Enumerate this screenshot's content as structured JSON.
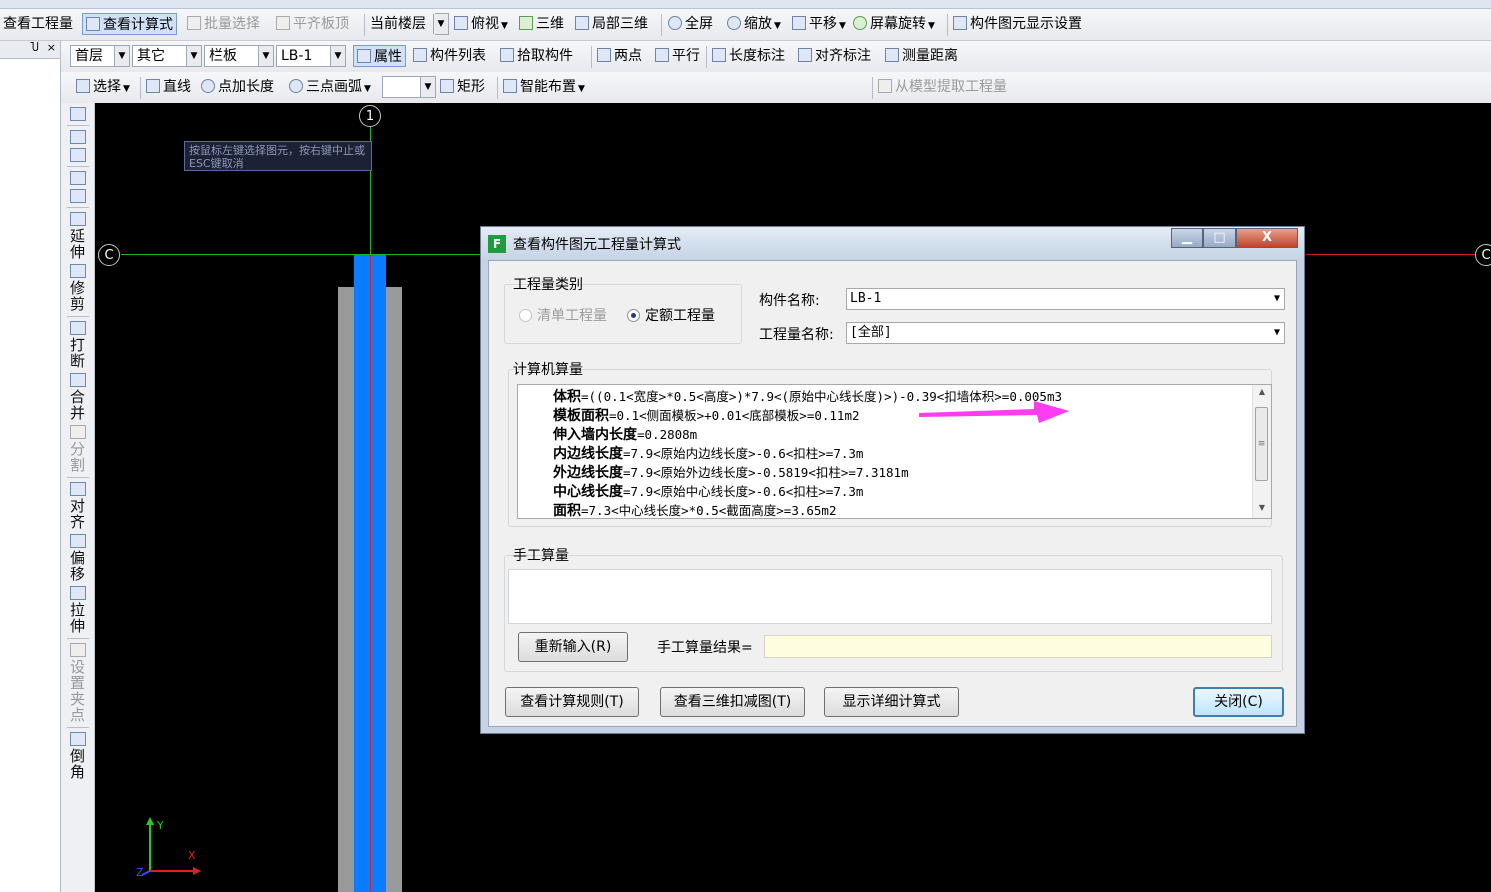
{
  "toolbar1": {
    "view_quantity": "查看工程量",
    "view_formula": "查看计算式",
    "batch_select": "批量选择",
    "align_slab_top": "平齐板顶",
    "current_floor": "当前楼层",
    "top_view": "俯视",
    "three_d": "三维",
    "local_3d": "局部三维",
    "fullscreen": "全屏",
    "zoom": "缩放",
    "pan": "平移",
    "screen_rotate": "屏幕旋转",
    "display_settings": "构件图元显示设置"
  },
  "toolbar2": {
    "floor_value": "首层",
    "category_value": "其它",
    "type_value": "栏板",
    "component_value": "LB-1",
    "properties": "属性",
    "component_list": "构件列表",
    "pick_component": "拾取构件",
    "two_points": "两点",
    "parallel": "平行",
    "length_dim": "长度标注",
    "align_dim": "对齐标注",
    "measure_distance": "测量距离"
  },
  "toolbar3": {
    "select": "选择",
    "line": "直线",
    "point_length": "点加长度",
    "three_point_arc": "三点画弧",
    "rect": "矩形",
    "smart_layout": "智能布置",
    "extract_from_model": "从模型提取工程量"
  },
  "left_panel": {
    "pin": "Ⴎ",
    "close": "×"
  },
  "vertical_tools": {
    "extend": "延伸",
    "trim": "修剪",
    "break": "打断",
    "merge": "合并",
    "split": "分割",
    "align": "对齐",
    "offset": "偏移",
    "stretch": "拉伸",
    "set_grip": "设置夹点",
    "chamfer": "倒角"
  },
  "canvas": {
    "hint": "按鼠标左键选择图元，按右键中止或ESC键取消",
    "axis_1": "1",
    "axis_c_left": "C",
    "axis_c_right": "C",
    "coord_y": "Y",
    "coord_x": "X",
    "coord_z": "Z"
  },
  "dialog": {
    "title": "查看构件图元工程量计算式",
    "window_buttons": {
      "minimize": "▁",
      "maximize": "□",
      "close": "X"
    },
    "quantity_type_label": "工程量类别",
    "radio_bill": "清单工程量",
    "radio_quota": "定额工程量",
    "component_name_label": "构件名称:",
    "component_name_value": "LB-1",
    "quantity_name_label": "工程量名称:",
    "quantity_name_value": "[全部]",
    "computer_calc_label": "计算机算量",
    "calc_lines": [
      {
        "name": "体积",
        "formula": "=((0.1<宽度>*0.5<高度>)*7.9<(原始中心线长度)>)-0.39<扣墙体积>=0.005m3"
      },
      {
        "name": "模板面积",
        "formula": "=0.1<侧面模板>+0.01<底部模板>=0.11m2"
      },
      {
        "name": "伸入墙内长度",
        "formula": "=0.2808m"
      },
      {
        "name": "内边线长度",
        "formula": "=7.9<原始内边线长度>-0.6<扣柱>=7.3m"
      },
      {
        "name": "外边线长度",
        "formula": "=7.9<原始外边线长度>-0.5819<扣柱>=7.3181m"
      },
      {
        "name": "中心线长度",
        "formula": "=7.9<原始中心线长度>-0.6<扣柱>=7.3m"
      },
      {
        "name": "面积",
        "formula": "=7.3<中心线长度>*0.5<截面高度>=3.65m2"
      }
    ],
    "manual_calc_label": "手工算量",
    "reinput_button": "重新输入(R)",
    "manual_result_label": "手工算量结果=",
    "view_rules_button": "查看计算规则(T)",
    "view_3d_deduct_button": "查看三维扣减图(T)",
    "show_detail_button": "显示详细计算式",
    "close_button": "关闭(C)"
  },
  "colors": {
    "canvas_bg": "#000000",
    "grid_green": "#1fb21f",
    "wall_blue": "#0a7cff",
    "wall_gray": "#9a9a9a",
    "annotation_arrow": "#ff3cf0"
  }
}
